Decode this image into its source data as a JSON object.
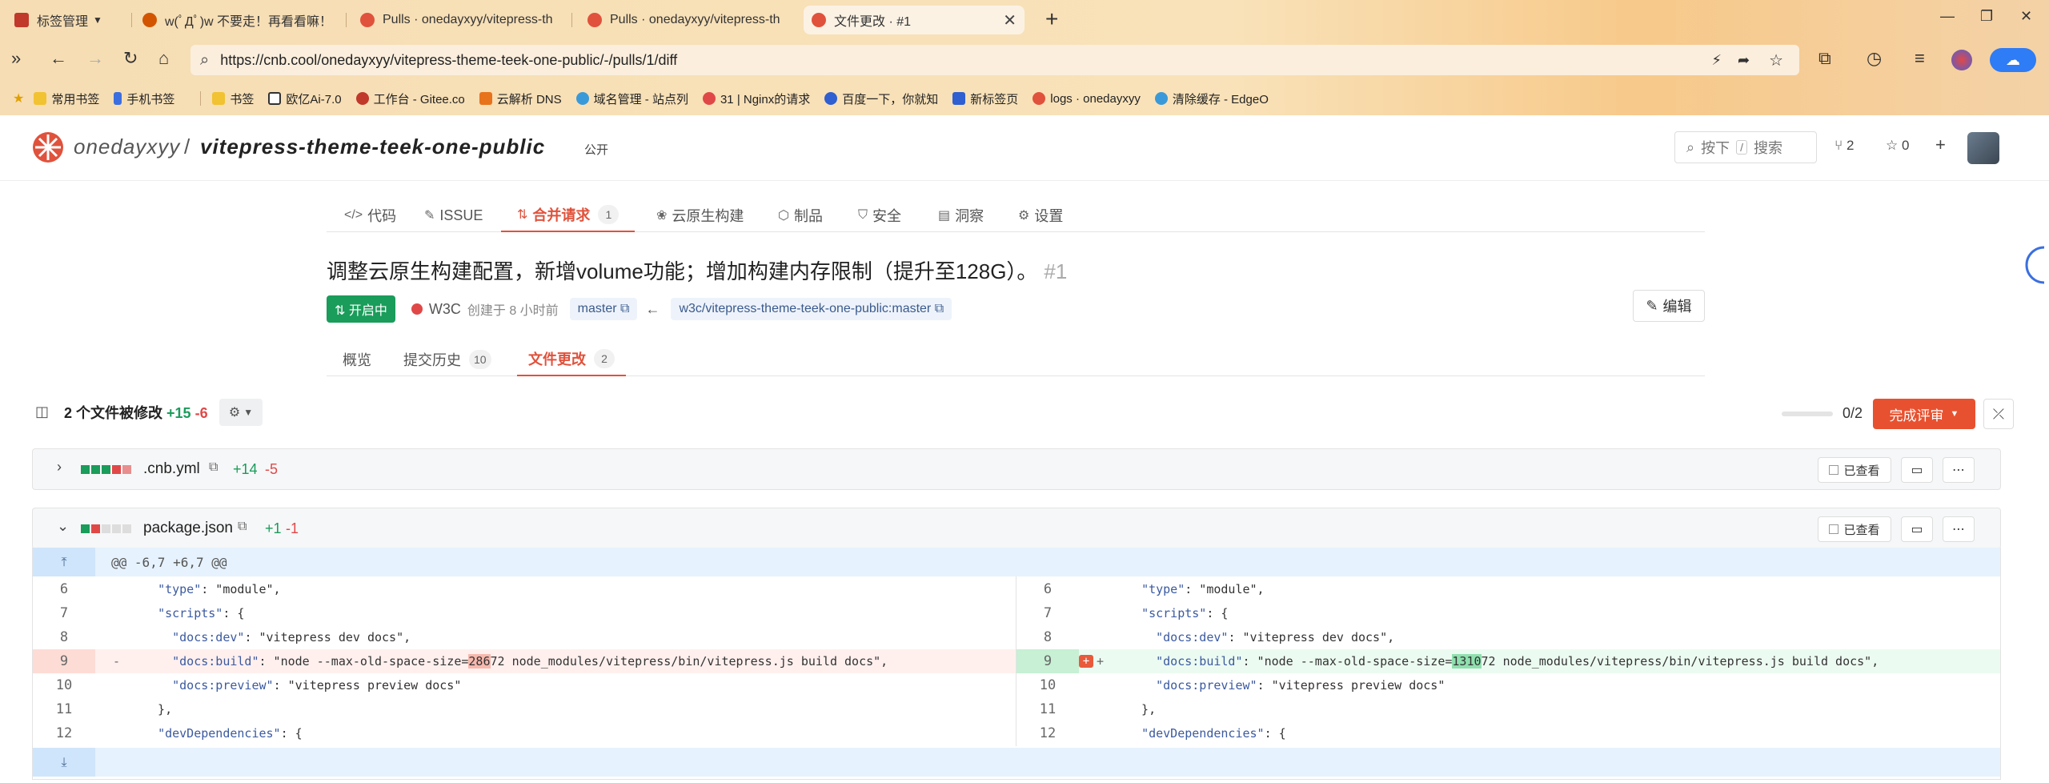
{
  "browser": {
    "tabs": [
      {
        "label": "标签管理",
        "color": "#c0392b"
      },
      {
        "label": "w(ﾟДﾟ)w 不要走！再看看嘛！",
        "color": "#d35400"
      },
      {
        "label": "Pulls · onedayxyy/vitepress-th",
        "color": "#e0523c"
      },
      {
        "label": "Pulls · onedayxyy/vitepress-th",
        "color": "#e0523c"
      },
      {
        "label": "文件更改 · #1",
        "color": "#e0523c"
      }
    ],
    "url": "https://cnb.cool/onedayxyy/vitepress-theme-teek-one-public/-/pulls/1/diff",
    "bookmarks": [
      {
        "label": "常用书签",
        "color": "#f1c232"
      },
      {
        "label": "手机书签",
        "color": "#3b6fe0"
      },
      {
        "label": "书签",
        "color": "#f1c232"
      },
      {
        "label": "欧亿Ai-7.0",
        "color": "#333333"
      },
      {
        "label": "工作台 - Gitee.co",
        "color": "#c0392b"
      },
      {
        "label": "云解析 DNS",
        "color": "#e8731d"
      },
      {
        "label": "域名管理 - 站点列",
        "color": "#3a9ad9"
      },
      {
        "label": "31 | Nginx的请求",
        "color": "#e04848"
      },
      {
        "label": "百度一下，你就知",
        "color": "#2f5fd0"
      },
      {
        "label": "新标签页",
        "color": "#2f5fd0"
      },
      {
        "label": "logs · onedayxyy",
        "color": "#e0523c"
      },
      {
        "label": "清除缓存 - EdgeO",
        "color": "#3a9ad9"
      }
    ]
  },
  "repo": {
    "owner": "onedayxyy",
    "slash": "/",
    "name": "vitepress-theme-teek-one-public",
    "visibility": "公开",
    "search_key": "按下",
    "search_key_hint": "/",
    "search_label": "搜索",
    "forks": "2",
    "stars": "0"
  },
  "nav": [
    {
      "label": "代码",
      "icon": "</>"
    },
    {
      "label": "ISSUE",
      "icon": "✎"
    },
    {
      "label": "合并请求",
      "icon": "⇅",
      "count": "1"
    },
    {
      "label": "云原生构建",
      "icon": "❀"
    },
    {
      "label": "制品",
      "icon": "⬡"
    },
    {
      "label": "安全",
      "icon": "⛉"
    },
    {
      "label": "洞察",
      "icon": "▤"
    },
    {
      "label": "设置",
      "icon": "⚙"
    }
  ],
  "pr": {
    "title": "调整云原生构建配置，新增volume功能；增加构建内存限制（提升至128G）。",
    "number": "#1",
    "status": "开启中",
    "author": "W3C",
    "created": "创建于 8 小时前",
    "target_branch": "master",
    "source_branch": "w3c/vitepress-theme-teek-one-public:master",
    "edit_label": "编辑"
  },
  "subtabs": [
    {
      "label": "概览"
    },
    {
      "label": "提交历史",
      "count": "10"
    },
    {
      "label": "文件更改",
      "count": "2"
    }
  ],
  "diff_summary": {
    "label": "2 个文件被修改",
    "additions": "+15",
    "deletions": "-6",
    "progress": "0/2",
    "progress_fraction": 0,
    "review_label": "完成评审"
  },
  "files": [
    {
      "name": ".cnb.yml",
      "additions": "+14",
      "deletions": "-5",
      "viewed_label": "已查看"
    },
    {
      "name": "package.json",
      "additions": "+1",
      "deletions": "-1",
      "viewed_label": "已查看"
    }
  ],
  "diff": {
    "hunk": "@@ -6,7 +6,7 @@",
    "left": [
      {
        "n": "6",
        "code": "  \"type\": \"module\","
      },
      {
        "n": "7",
        "code": "  \"scripts\": {"
      },
      {
        "n": "8",
        "code": "    \"docs:dev\": \"vitepress dev docs\","
      },
      {
        "n": "9",
        "pre": "    \"docs:build\": \"node --max-old-space-size=",
        "hl": "286",
        "post": "72 node_modules/vitepress/bin/vitepress.js build docs\",",
        "sign": "-"
      },
      {
        "n": "10",
        "code": "    \"docs:preview\": \"vitepress preview docs\""
      },
      {
        "n": "11",
        "code": "  },"
      },
      {
        "n": "12",
        "code": "  \"devDependencies\": {"
      }
    ],
    "right": [
      {
        "n": "6",
        "code": "  \"type\": \"module\","
      },
      {
        "n": "7",
        "code": "  \"scripts\": {"
      },
      {
        "n": "8",
        "code": "    \"docs:dev\": \"vitepress dev docs\","
      },
      {
        "n": "9",
        "pre": "    \"docs:build\": \"node --max-old-space-size=",
        "hl": "1310",
        "post": "72 node_modules/vitepress/bin/vitepress.js build docs\",",
        "sign": "+"
      },
      {
        "n": "10",
        "code": "    \"docs:preview\": \"vitepress preview docs\""
      },
      {
        "n": "11",
        "code": "  },"
      },
      {
        "n": "12",
        "code": "  \"devDependencies\": {"
      }
    ]
  },
  "colors": {
    "accent": "#e0523c",
    "open": "#1a9c5a",
    "add": "#1a9c5a",
    "del": "#e04848"
  }
}
